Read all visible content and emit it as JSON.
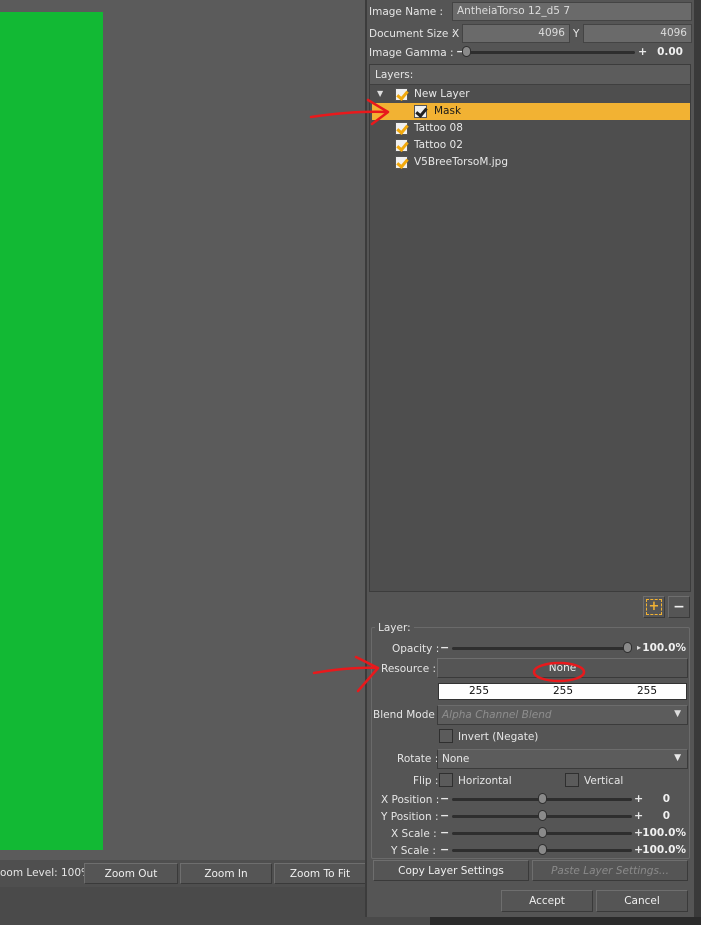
{
  "zoom": {
    "label": "oom Level: 100%",
    "zoom_out": "Zoom Out",
    "zoom_in": "Zoom In",
    "zoom_fit": "Zoom To Fit"
  },
  "image": {
    "name_label": "Image Name :",
    "name_value": "AntheiaTorso 12_d5 7",
    "doc_size_label": "Document Size :",
    "x_label": "X",
    "x_value": "4096",
    "y_label": "Y",
    "y_value": "4096",
    "gamma_label": "Image Gamma :",
    "gamma_value": "0.00"
  },
  "layers": {
    "header": "Layers:",
    "items": [
      {
        "label": "New Layer",
        "checked": true,
        "expanded": true
      },
      {
        "label": "Mask",
        "checked": true,
        "selected": true
      },
      {
        "label": "Tattoo 08",
        "checked": true
      },
      {
        "label": "Tattoo 02",
        "checked": true
      },
      {
        "label": "V5BreeTorsoM.jpg",
        "checked": true
      }
    ],
    "add_icon": "add-layer-icon",
    "remove_icon": "remove-layer-icon"
  },
  "layer": {
    "group_label": "Layer:",
    "opacity_label": "Opacity :",
    "opacity_value": "100.0%",
    "opacity_fraction": 1.0,
    "resource_label": "Resource :",
    "resource_value": "None",
    "rgb": [
      "255",
      "255",
      "255"
    ],
    "blend_label": "Blend Mode :",
    "blend_value": "Alpha Channel Blend",
    "invert_label": "Invert (Negate)",
    "rotate_label": "Rotate :",
    "rotate_value": "None",
    "flip_label": "Flip :",
    "flip_h": "Horizontal",
    "flip_v": "Vertical",
    "xpos_label": "X Position :",
    "xpos_value": "0",
    "ypos_label": "Y Position :",
    "ypos_value": "0",
    "xscale_label": "X Scale :",
    "xscale_value": "100.0%",
    "yscale_label": "Y Scale :",
    "yscale_value": "100.0%",
    "copy_label": "Copy Layer Settings",
    "paste_label": "Paste Layer Settings..."
  },
  "dialog": {
    "accept": "Accept",
    "cancel": "Cancel"
  },
  "colors": {
    "canvas": "#12b934",
    "selection": "#f2b233",
    "annotation": "#e8191c"
  }
}
